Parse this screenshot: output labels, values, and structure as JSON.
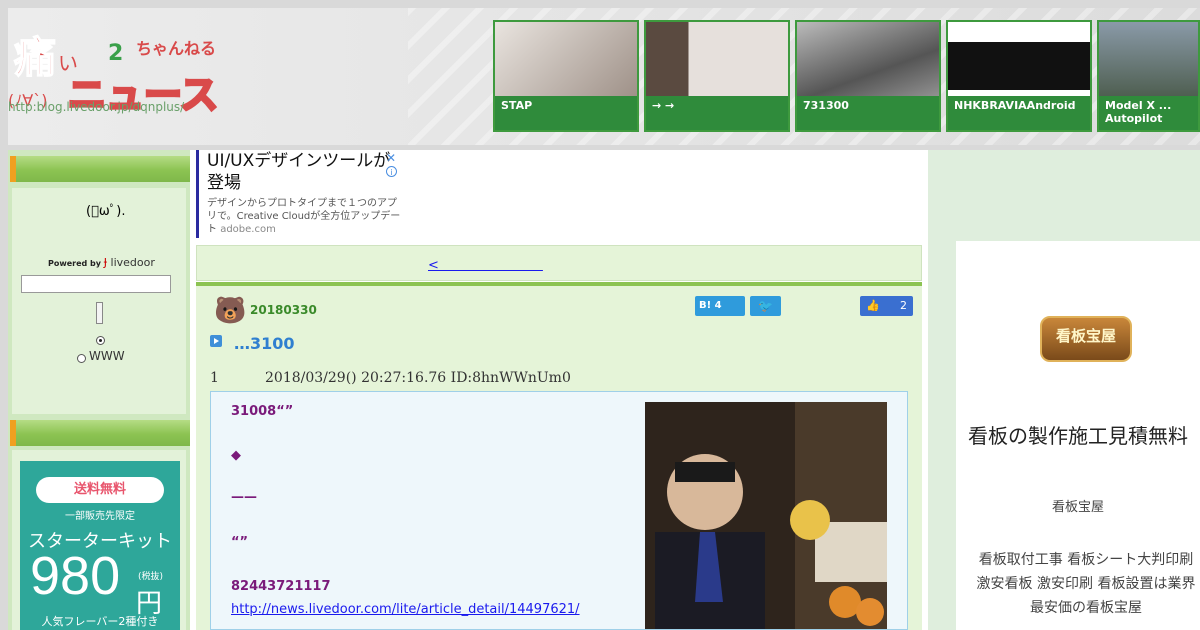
{
  "header": {
    "logo_text": "痛いニュース",
    "logo_suffix": "2ちゃんねる",
    "logo_face": "(ノ∀`)",
    "logo_url": "http:blog.livedoor.jp/dqnplus/",
    "thumbnails": [
      {
        "caption": "STAP"
      },
      {
        "caption": "→ →"
      },
      {
        "caption": "731300"
      },
      {
        "caption": "NHKBRAVIAAndroid"
      },
      {
        "caption": "Model X ... Autopilot"
      }
    ]
  },
  "sidebar": {
    "mascot": "(ﾟωﾟ).",
    "powered_by": "Powered by",
    "livedoor": "livedoor",
    "search_option_web": "WWW"
  },
  "left_ad": {
    "badge": "送料無料",
    "limited": "一部販売先限定",
    "kit": "スターターキット",
    "price": "980",
    "tax": "(税抜)",
    "yen": "円",
    "flavor": "人気フレーバー2種付き"
  },
  "top_ad": {
    "title": "UI/UXデザインツールが登場",
    "desc": "デザインからプロトタイプまで１つのアプリで。Creative Cloudが全方位アップデート",
    "source": "adobe.com"
  },
  "nav": {
    "prev_label": "<　　　　　　　　"
  },
  "article": {
    "date": "20180330",
    "hatena_count": "B! 4",
    "tweet": "🐦",
    "like_count": "2",
    "title": "…3100",
    "res_number": "1",
    "res_meta": "2018/03/29() 20:27:16.76 ID:8hnWWnUm0",
    "lines": [
      "31008“”",
      "◆",
      "——",
      "“”",
      "82443721117"
    ],
    "link": "http://news.livedoor.com/lite/article_detail/14497621/"
  },
  "right": {
    "logo": "看板宝屋",
    "title": "看板の製作施工見積無料",
    "brand": "看板宝屋",
    "desc": "看板取付工事 看板シート大判印刷 激安看板 激安印刷 看板設置は業界最安価の看板宝屋"
  }
}
